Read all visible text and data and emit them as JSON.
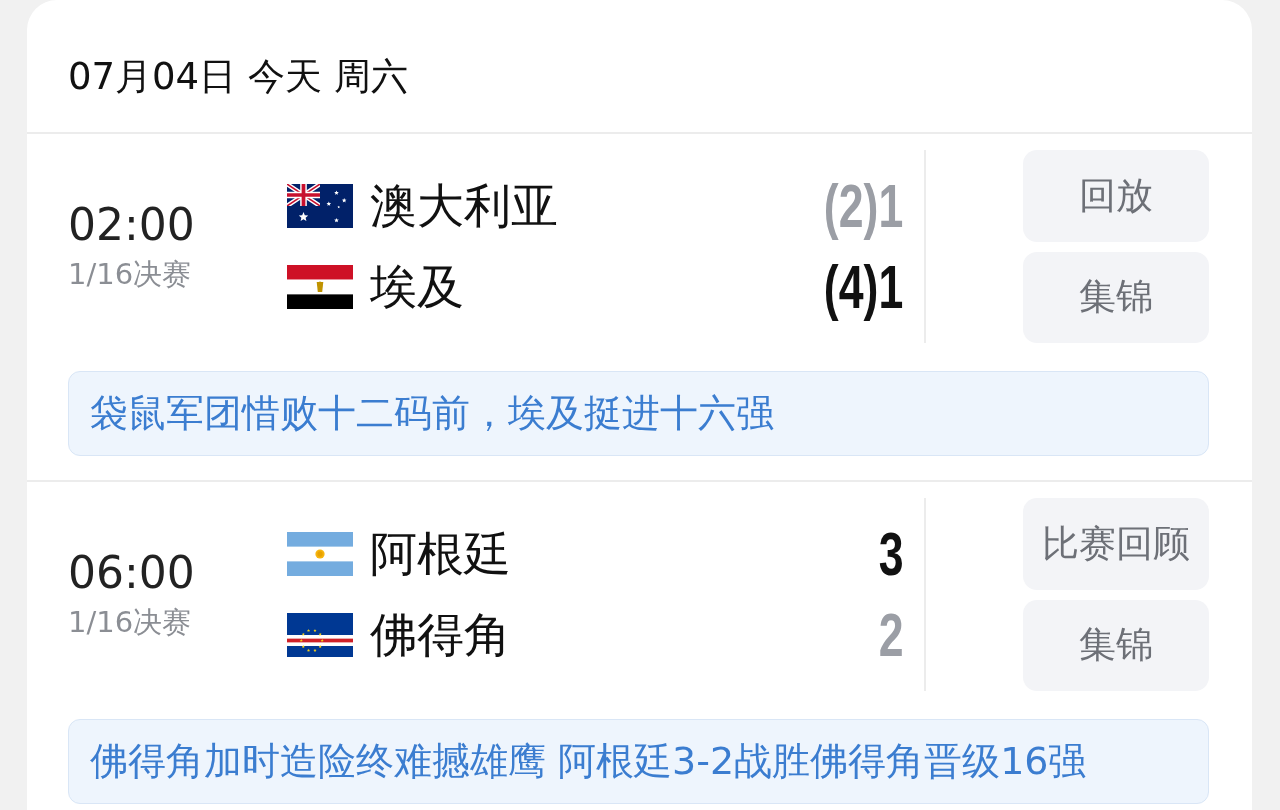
{
  "date_header": "07月04日 今天 周六",
  "matches": [
    {
      "time": "02:00",
      "stage": "1/16决赛",
      "teams": [
        {
          "name": "澳大利亚",
          "kind": "australia",
          "score": "(2)1",
          "winner": false
        },
        {
          "name": "埃及",
          "kind": "egypt",
          "score": "(4)1",
          "winner": true
        }
      ],
      "buttons": [
        "回放",
        "集锦"
      ],
      "summary": "袋鼠军团惜败十二码前，埃及挺进十六强"
    },
    {
      "time": "06:00",
      "stage": "1/16决赛",
      "teams": [
        {
          "name": "阿根廷",
          "kind": "argentina",
          "score": "3",
          "winner": true
        },
        {
          "name": "佛得角",
          "kind": "capeverde",
          "score": "2",
          "winner": false
        }
      ],
      "buttons": [
        "比赛回顾",
        "集锦"
      ],
      "summary": "佛得角加时造险终难撼雄鹰 阿根廷3-2战胜佛得角晋级16强"
    }
  ]
}
